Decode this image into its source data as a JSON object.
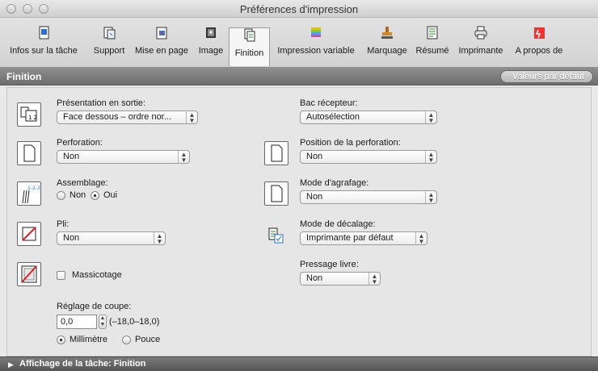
{
  "window": {
    "title": "Préférences d'impression"
  },
  "toolbar": {
    "items": [
      {
        "label": "Infos sur la tâche",
        "icon": "document-info-icon"
      },
      {
        "label": "Support",
        "icon": "paper-icon"
      },
      {
        "label": "Mise en page",
        "icon": "layout-icon"
      },
      {
        "label": "Image",
        "icon": "image-icon"
      },
      {
        "label": "Finition",
        "icon": "finishing-icon"
      },
      {
        "label": "Impression variable",
        "icon": "variable-print-icon"
      },
      {
        "label": "Marquage",
        "icon": "stamp-icon"
      },
      {
        "label": "Résumé",
        "icon": "summary-icon"
      },
      {
        "label": "Imprimante",
        "icon": "printer-icon"
      },
      {
        "label": "A propos de",
        "icon": "about-icon"
      }
    ],
    "active": "Finition"
  },
  "section": {
    "title": "Finition",
    "defaults_button": "Valeurs par défaut"
  },
  "fields": {
    "output_presentation": {
      "label": "Présentation en sortie:",
      "value": "Face dessous – ordre nor..."
    },
    "output_tray": {
      "label": "Bac récepteur:",
      "value": "Autosélection"
    },
    "punch": {
      "label": "Perforation:",
      "value": "Non"
    },
    "punch_position": {
      "label": "Position de la perforation:",
      "value": "Non"
    },
    "collate": {
      "label": "Assemblage:",
      "option_no": "Non",
      "option_yes": "Oui",
      "selected": "Oui"
    },
    "staple_mode": {
      "label": "Mode d'agrafage:",
      "value": "Non"
    },
    "fold": {
      "label": "Pli:",
      "value": "Non"
    },
    "offset_mode": {
      "label": "Mode de décalage:",
      "value": "Imprimante par défaut"
    },
    "trim": {
      "label": "Massicotage",
      "checked": false
    },
    "book_press": {
      "label": "Pressage livre:",
      "value": "Non"
    },
    "trim_adjust": {
      "label": "Réglage de coupe:",
      "value": "0,0",
      "range": "(–18,0–18,0)",
      "unit_mm": "Millimètre",
      "unit_in": "Pouce",
      "selected_unit": "Millimètre"
    }
  },
  "footer": {
    "label": "Affichage de la tâche: Finition"
  }
}
